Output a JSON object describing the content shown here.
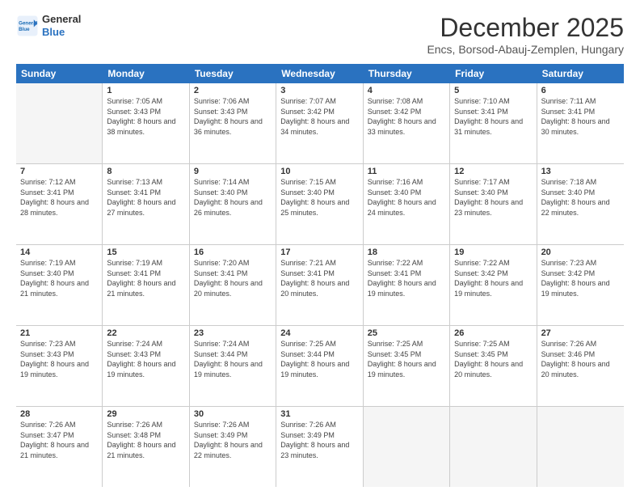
{
  "logo": {
    "line1": "General",
    "line2": "Blue"
  },
  "title": "December 2025",
  "location": "Encs, Borsod-Abauj-Zemplen, Hungary",
  "days": [
    "Sunday",
    "Monday",
    "Tuesday",
    "Wednesday",
    "Thursday",
    "Friday",
    "Saturday"
  ],
  "weeks": [
    [
      {
        "day": "",
        "empty": true
      },
      {
        "day": "1",
        "sunrise": "7:05 AM",
        "sunset": "3:43 PM",
        "daylight": "8 hours and 38 minutes."
      },
      {
        "day": "2",
        "sunrise": "7:06 AM",
        "sunset": "3:43 PM",
        "daylight": "8 hours and 36 minutes."
      },
      {
        "day": "3",
        "sunrise": "7:07 AM",
        "sunset": "3:42 PM",
        "daylight": "8 hours and 34 minutes."
      },
      {
        "day": "4",
        "sunrise": "7:08 AM",
        "sunset": "3:42 PM",
        "daylight": "8 hours and 33 minutes."
      },
      {
        "day": "5",
        "sunrise": "7:10 AM",
        "sunset": "3:41 PM",
        "daylight": "8 hours and 31 minutes."
      },
      {
        "day": "6",
        "sunrise": "7:11 AM",
        "sunset": "3:41 PM",
        "daylight": "8 hours and 30 minutes."
      }
    ],
    [
      {
        "day": "7",
        "sunrise": "7:12 AM",
        "sunset": "3:41 PM",
        "daylight": "8 hours and 28 minutes."
      },
      {
        "day": "8",
        "sunrise": "7:13 AM",
        "sunset": "3:41 PM",
        "daylight": "8 hours and 27 minutes."
      },
      {
        "day": "9",
        "sunrise": "7:14 AM",
        "sunset": "3:40 PM",
        "daylight": "8 hours and 26 minutes."
      },
      {
        "day": "10",
        "sunrise": "7:15 AM",
        "sunset": "3:40 PM",
        "daylight": "8 hours and 25 minutes."
      },
      {
        "day": "11",
        "sunrise": "7:16 AM",
        "sunset": "3:40 PM",
        "daylight": "8 hours and 24 minutes."
      },
      {
        "day": "12",
        "sunrise": "7:17 AM",
        "sunset": "3:40 PM",
        "daylight": "8 hours and 23 minutes."
      },
      {
        "day": "13",
        "sunrise": "7:18 AM",
        "sunset": "3:40 PM",
        "daylight": "8 hours and 22 minutes."
      }
    ],
    [
      {
        "day": "14",
        "sunrise": "7:19 AM",
        "sunset": "3:40 PM",
        "daylight": "8 hours and 21 minutes."
      },
      {
        "day": "15",
        "sunrise": "7:19 AM",
        "sunset": "3:41 PM",
        "daylight": "8 hours and 21 minutes."
      },
      {
        "day": "16",
        "sunrise": "7:20 AM",
        "sunset": "3:41 PM",
        "daylight": "8 hours and 20 minutes."
      },
      {
        "day": "17",
        "sunrise": "7:21 AM",
        "sunset": "3:41 PM",
        "daylight": "8 hours and 20 minutes."
      },
      {
        "day": "18",
        "sunrise": "7:22 AM",
        "sunset": "3:41 PM",
        "daylight": "8 hours and 19 minutes."
      },
      {
        "day": "19",
        "sunrise": "7:22 AM",
        "sunset": "3:42 PM",
        "daylight": "8 hours and 19 minutes."
      },
      {
        "day": "20",
        "sunrise": "7:23 AM",
        "sunset": "3:42 PM",
        "daylight": "8 hours and 19 minutes."
      }
    ],
    [
      {
        "day": "21",
        "sunrise": "7:23 AM",
        "sunset": "3:43 PM",
        "daylight": "8 hours and 19 minutes."
      },
      {
        "day": "22",
        "sunrise": "7:24 AM",
        "sunset": "3:43 PM",
        "daylight": "8 hours and 19 minutes."
      },
      {
        "day": "23",
        "sunrise": "7:24 AM",
        "sunset": "3:44 PM",
        "daylight": "8 hours and 19 minutes."
      },
      {
        "day": "24",
        "sunrise": "7:25 AM",
        "sunset": "3:44 PM",
        "daylight": "8 hours and 19 minutes."
      },
      {
        "day": "25",
        "sunrise": "7:25 AM",
        "sunset": "3:45 PM",
        "daylight": "8 hours and 19 minutes."
      },
      {
        "day": "26",
        "sunrise": "7:25 AM",
        "sunset": "3:45 PM",
        "daylight": "8 hours and 20 minutes."
      },
      {
        "day": "27",
        "sunrise": "7:26 AM",
        "sunset": "3:46 PM",
        "daylight": "8 hours and 20 minutes."
      }
    ],
    [
      {
        "day": "28",
        "sunrise": "7:26 AM",
        "sunset": "3:47 PM",
        "daylight": "8 hours and 21 minutes."
      },
      {
        "day": "29",
        "sunrise": "7:26 AM",
        "sunset": "3:48 PM",
        "daylight": "8 hours and 21 minutes."
      },
      {
        "day": "30",
        "sunrise": "7:26 AM",
        "sunset": "3:49 PM",
        "daylight": "8 hours and 22 minutes."
      },
      {
        "day": "31",
        "sunrise": "7:26 AM",
        "sunset": "3:49 PM",
        "daylight": "8 hours and 23 minutes."
      },
      {
        "day": "",
        "empty": true
      },
      {
        "day": "",
        "empty": true
      },
      {
        "day": "",
        "empty": true
      }
    ]
  ]
}
